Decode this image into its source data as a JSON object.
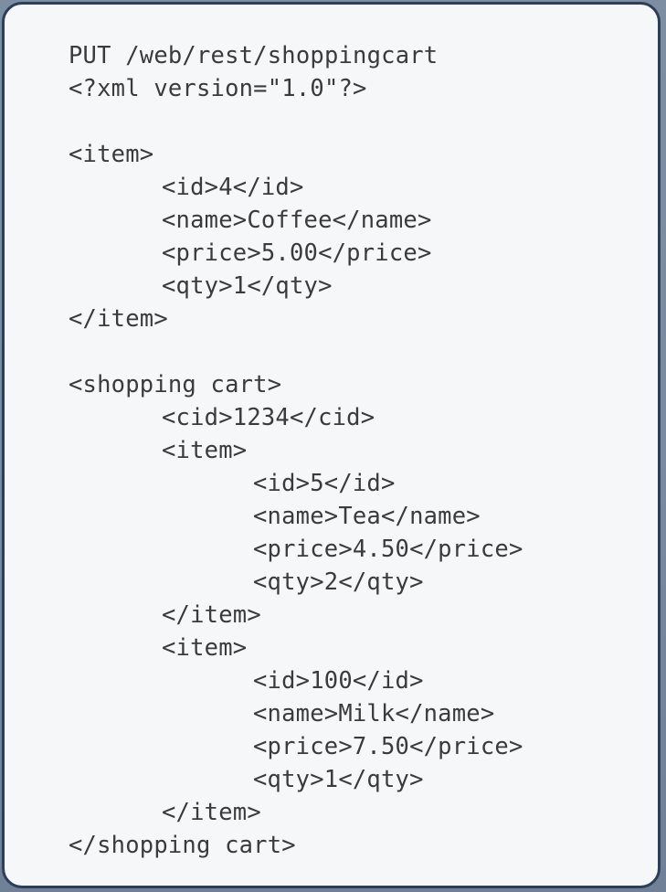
{
  "code": {
    "lines": [
      "PUT /web/rest/shoppingcart",
      "<?xml version=\"1.0\"?>",
      "",
      "<item>",
      "<id>4</id>",
      "<name>Coffee</name>",
      "<price>5.00</price>",
      "<qty>1</qty>",
      "</item>",
      "",
      "<shopping cart>",
      "<cid>1234</cid>",
      "<item>",
      "<id>5</id>",
      "<name>Tea</name>",
      "<price>4.50</price>",
      "<qty>2</qty>",
      "</item>",
      "<item>",
      "<id>100</id>",
      "<name>Milk</name>",
      "<price>7.50</price>",
      "<qty>1</qty>",
      "</item>",
      "</shopping cart>"
    ]
  }
}
